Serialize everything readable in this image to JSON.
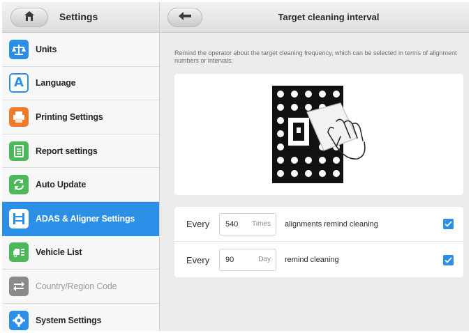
{
  "sidebar": {
    "title": "Settings",
    "items": [
      {
        "label": "Units",
        "icon": "scale-icon",
        "color": "#2b8fe8"
      },
      {
        "label": "Language",
        "icon": "letter-a-icon",
        "color": "#2b8fe8"
      },
      {
        "label": "Printing Settings",
        "icon": "printer-icon",
        "color": "#f07a2c"
      },
      {
        "label": "Report settings",
        "icon": "report-icon",
        "color": "#4cb85a"
      },
      {
        "label": "Auto Update",
        "icon": "refresh-icon",
        "color": "#4cb85a"
      },
      {
        "label": "ADAS & Aligner Settings",
        "icon": "aligner-icon",
        "color": "#2b8fe8",
        "active": true
      },
      {
        "label": "Vehicle List",
        "icon": "vehicle-list-icon",
        "color": "#4cb85a"
      },
      {
        "label": "Country/Region Code",
        "icon": "swap-arrows-icon",
        "color": "#8a8a8a",
        "disabled": true
      },
      {
        "label": "System Settings",
        "icon": "gear-icon",
        "color": "#2b8fe8"
      }
    ]
  },
  "main": {
    "title": "Target cleaning interval",
    "description": "Remind the operator about the target cleaning frequency, which can be selected in terms of alignment numbers or intervals.",
    "rows": [
      {
        "prefix": "Every",
        "value": "540",
        "unit": "Times",
        "label": "alignments remind cleaning",
        "checked": true
      },
      {
        "prefix": "Every",
        "value": "90",
        "unit": "Day",
        "label": "remind cleaning",
        "checked": true
      }
    ]
  },
  "colors": {
    "accent": "#2b8fe8",
    "active_item_text": "#ffffff"
  }
}
